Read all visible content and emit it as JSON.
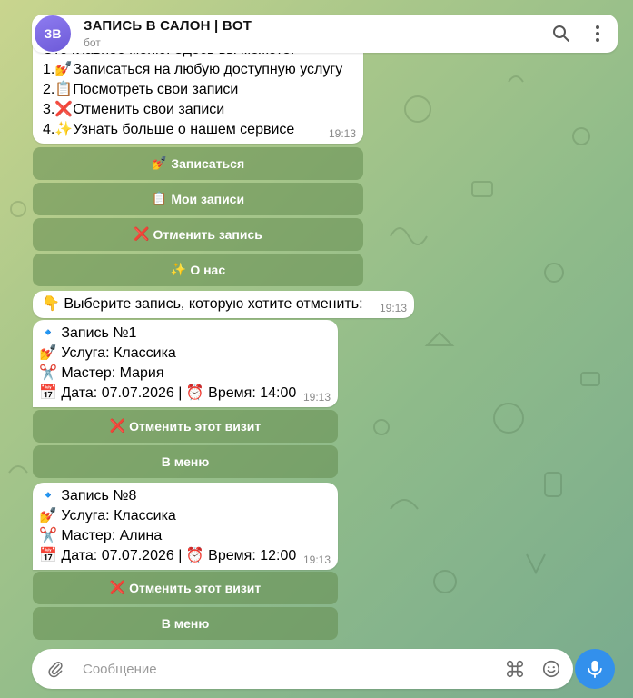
{
  "header": {
    "avatar_initials": "ЗВ",
    "title": "ЗАПИСЬ В САЛОН | BOT",
    "subtitle": "бот"
  },
  "menu_message": {
    "partial_top": "Это главное меню. Здесь вы можете:",
    "lines": [
      "1.💅Записаться на любую доступную услугу",
      "2.📋Посмотреть свои записи",
      "3.❌Отменить свои записи",
      "4.✨Узнать больше о нашем сервисе"
    ],
    "time": "19:13"
  },
  "menu_buttons": [
    {
      "emoji": "💅",
      "label": "Записаться"
    },
    {
      "emoji": "📋",
      "label": "Мои записи"
    },
    {
      "emoji": "❌",
      "label": "Отменить запись"
    },
    {
      "emoji": "✨",
      "label": "О нас"
    }
  ],
  "prompt_message": {
    "text": "👇 Выберите запись, которую хотите отменить:",
    "time": "19:13"
  },
  "bookings": [
    {
      "lines": [
        "🔹 Запись №1",
        "💅 Услуга: Классика",
        "✂️ Мастер: Мария",
        "📅 Дата: 07.07.2026 | ⏰ Время: 14:00"
      ],
      "time": "19:13",
      "cancel_label": "Отменить этот визит",
      "cancel_emoji": "❌",
      "menu_label": "В меню"
    },
    {
      "lines": [
        "🔹 Запись №8",
        "💅 Услуга: Классика",
        "✂️ Мастер: Алина",
        "📅 Дата: 07.07.2026 | ⏰ Время: 12:00"
      ],
      "time": "19:13",
      "cancel_label": "Отменить этот визит",
      "cancel_emoji": "❌",
      "menu_label": "В меню"
    }
  ],
  "input": {
    "placeholder": "Сообщение"
  },
  "colors": {
    "accent": "#3390ec",
    "avatar": "#7b68e6",
    "keyboard_button": "#7f9a66"
  }
}
